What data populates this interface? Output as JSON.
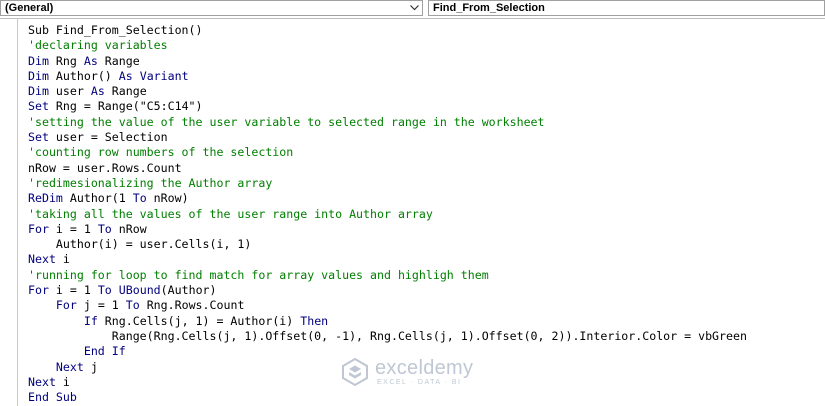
{
  "toolbar": {
    "object_combo": "(General)",
    "procedure_combo": "Find_From_Selection"
  },
  "code_lines": [
    [
      {
        "t": "Sub Find_From_Selection()",
        "c": "plain"
      }
    ],
    [
      {
        "t": "'declaring variables",
        "c": "comment"
      }
    ],
    [
      {
        "t": "Dim",
        "c": "kw"
      },
      {
        "t": " Rng ",
        "c": "plain"
      },
      {
        "t": "As",
        "c": "kw"
      },
      {
        "t": " Range",
        "c": "plain"
      }
    ],
    [
      {
        "t": "Dim",
        "c": "kw"
      },
      {
        "t": " Author() ",
        "c": "plain"
      },
      {
        "t": "As",
        "c": "kw"
      },
      {
        "t": " ",
        "c": "plain"
      },
      {
        "t": "Variant",
        "c": "kw"
      }
    ],
    [
      {
        "t": "Dim",
        "c": "kw"
      },
      {
        "t": " user ",
        "c": "plain"
      },
      {
        "t": "As",
        "c": "kw"
      },
      {
        "t": " Range",
        "c": "plain"
      }
    ],
    [
      {
        "t": "Set",
        "c": "kw"
      },
      {
        "t": " Rng = Range(\"C5:C14\")",
        "c": "plain"
      }
    ],
    [
      {
        "t": "'setting the value of the user variable to selected range in the worksheet",
        "c": "comment"
      }
    ],
    [
      {
        "t": "Set",
        "c": "kw"
      },
      {
        "t": " user = Selection",
        "c": "plain"
      }
    ],
    [
      {
        "t": "'counting row numbers of the selection",
        "c": "comment"
      }
    ],
    [
      {
        "t": "nRow = user.Rows.Count",
        "c": "plain"
      }
    ],
    [
      {
        "t": "'redimesionalizing the Author array",
        "c": "comment"
      }
    ],
    [
      {
        "t": "ReDim",
        "c": "kw"
      },
      {
        "t": " Author(1 ",
        "c": "plain"
      },
      {
        "t": "To",
        "c": "kw"
      },
      {
        "t": " nRow)",
        "c": "plain"
      }
    ],
    [
      {
        "t": "'taking all the values of the user range into Author array",
        "c": "comment"
      }
    ],
    [
      {
        "t": "For",
        "c": "kw"
      },
      {
        "t": " i = 1 ",
        "c": "plain"
      },
      {
        "t": "To",
        "c": "kw"
      },
      {
        "t": " nRow",
        "c": "plain"
      }
    ],
    [
      {
        "t": "    Author(i) = user.Cells(i, 1)",
        "c": "plain"
      }
    ],
    [
      {
        "t": "Next",
        "c": "kw"
      },
      {
        "t": " i",
        "c": "plain"
      }
    ],
    [
      {
        "t": "'running for loop to find match for array values and highligh them",
        "c": "comment"
      }
    ],
    [
      {
        "t": "For",
        "c": "kw"
      },
      {
        "t": " i = 1 ",
        "c": "plain"
      },
      {
        "t": "To",
        "c": "kw"
      },
      {
        "t": " ",
        "c": "plain"
      },
      {
        "t": "UBound",
        "c": "kw"
      },
      {
        "t": "(Author)",
        "c": "plain"
      }
    ],
    [
      {
        "t": "    ",
        "c": "plain"
      },
      {
        "t": "For",
        "c": "kw"
      },
      {
        "t": " j = 1 ",
        "c": "plain"
      },
      {
        "t": "To",
        "c": "kw"
      },
      {
        "t": " Rng.Rows.Count",
        "c": "plain"
      }
    ],
    [
      {
        "t": "        ",
        "c": "plain"
      },
      {
        "t": "If",
        "c": "kw"
      },
      {
        "t": " Rng.Cells(j, 1) = Author(i) ",
        "c": "plain"
      },
      {
        "t": "Then",
        "c": "kw"
      }
    ],
    [
      {
        "t": "            Range(Rng.Cells(j, 1).Offset(0, -1), Rng.Cells(j, 1).Offset(0, 2)).Interior.Color = vbGreen",
        "c": "plain"
      }
    ],
    [
      {
        "t": "        ",
        "c": "plain"
      },
      {
        "t": "End If",
        "c": "kw"
      }
    ],
    [
      {
        "t": "    ",
        "c": "plain"
      },
      {
        "t": "Next",
        "c": "kw"
      },
      {
        "t": " j",
        "c": "plain"
      }
    ],
    [
      {
        "t": "Next",
        "c": "kw"
      },
      {
        "t": " i",
        "c": "plain"
      }
    ],
    [
      {
        "t": "End Sub",
        "c": "kw"
      }
    ]
  ],
  "watermark": {
    "title": "exceldemy",
    "subtitle": "EXCEL · DATA · BI",
    "icon": "exceldemy-logo-icon"
  },
  "colors": {
    "keyword": "#00007f",
    "comment": "#007f00",
    "plain": "#000000"
  }
}
